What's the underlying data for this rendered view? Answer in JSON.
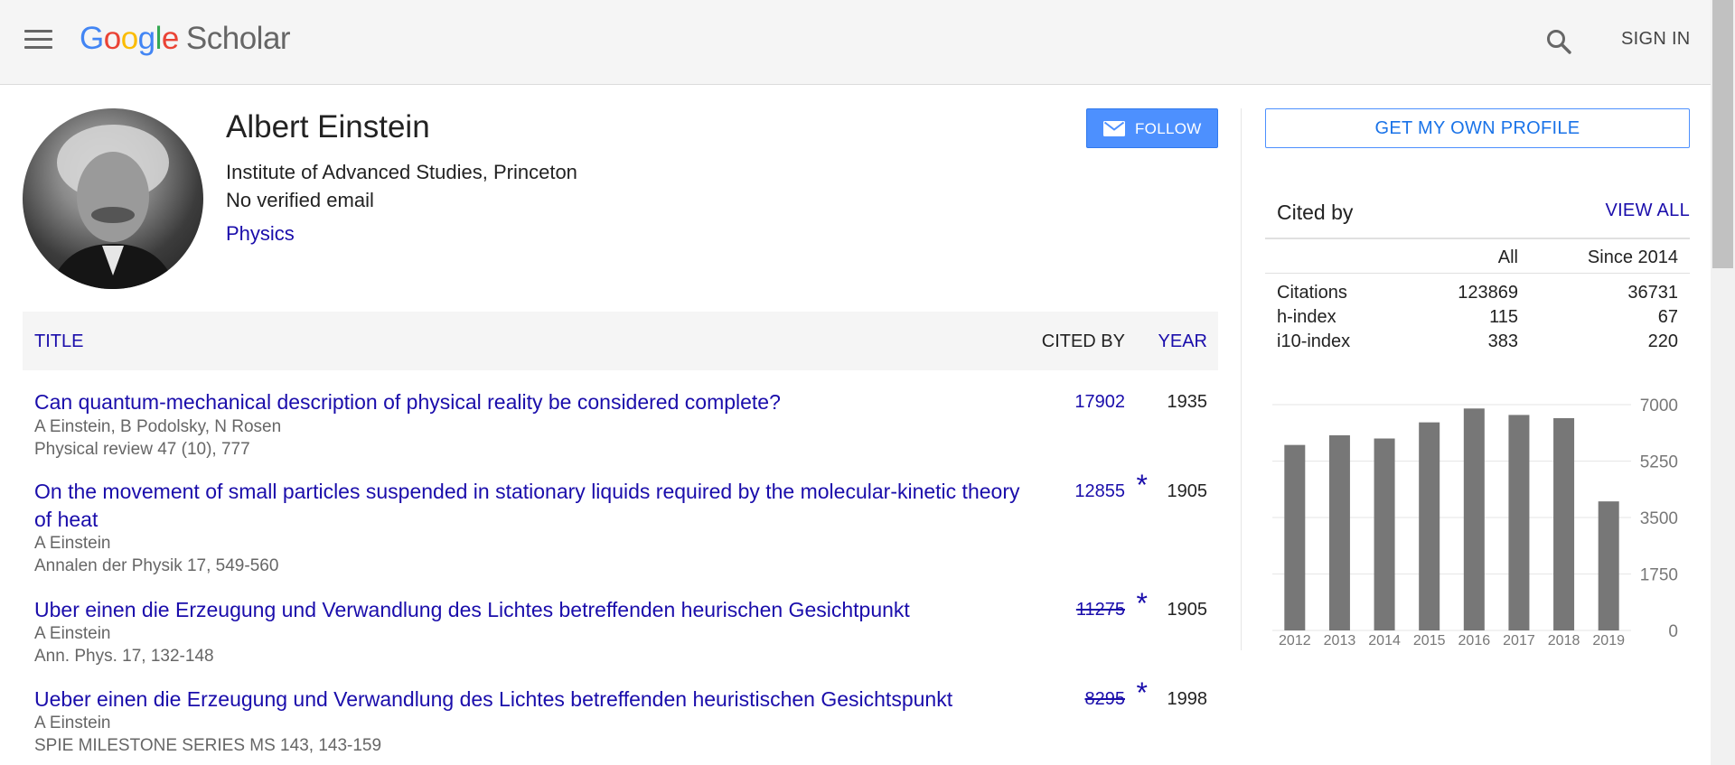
{
  "header": {
    "logo_google": "Google",
    "logo_scholar": "Scholar",
    "sign_in": "SIGN IN"
  },
  "profile": {
    "name": "Albert Einstein",
    "affiliation": "Institute of Advanced Studies, Princeton",
    "email": "No verified email",
    "interest": "Physics",
    "follow_label": "FOLLOW"
  },
  "table": {
    "col_title": "TITLE",
    "col_cited_by": "CITED BY",
    "col_year": "YEAR",
    "rows": [
      {
        "title": "Can quantum-mechanical description of physical reality be considered complete?",
        "authors": "A Einstein, B Podolsky, N Rosen",
        "publication": "Physical review 47 (10), 777",
        "cited_by": "17902",
        "star": "",
        "year": "1935"
      },
      {
        "title": "On the movement of small particles suspended in stationary liquids required by the molecular-kinetic theory of heat",
        "authors": "A Einstein",
        "publication": "Annalen der Physik 17, 549-560",
        "cited_by": "12855",
        "star": "*",
        "year": "1905"
      },
      {
        "title": "Uber einen die Erzeugung und Verwandlung des Lichtes betreffenden heurischen Gesichtpunkt",
        "authors": "A Einstein",
        "publication": "Ann. Phys. 17, 132-148",
        "cited_by": "11275",
        "star": "*",
        "year": "1905"
      },
      {
        "title": "Ueber einen die Erzeugung und Verwandlung des Lichtes betreffenden heuristischen Gesichtspunkt",
        "authors": "A Einstein",
        "publication": "SPIE MILESTONE SERIES MS 143, 143-159",
        "cited_by": "8295",
        "star": "*",
        "year": "1998"
      }
    ]
  },
  "sidebar": {
    "get_profile": "GET MY OWN PROFILE",
    "cited_by_title": "Cited by",
    "view_all": "VIEW ALL",
    "col_all": "All",
    "col_since": "Since 2014",
    "metrics": [
      {
        "label": "Citations",
        "all": "123869",
        "since": "36731"
      },
      {
        "label": "h-index",
        "all": "115",
        "since": "67"
      },
      {
        "label": "i10-index",
        "all": "383",
        "since": "220"
      }
    ]
  },
  "colors": {
    "link": "#1a0dab",
    "follow_button": "#4d90fe",
    "bar": "#777777",
    "header_bg": "#f5f5f5"
  },
  "chart_data": {
    "type": "bar",
    "categories": [
      "2012",
      "2013",
      "2014",
      "2015",
      "2016",
      "2017",
      "2018",
      "2019"
    ],
    "values": [
      5750,
      6050,
      5950,
      6450,
      6880,
      6680,
      6580,
      4000
    ],
    "ylim": [
      0,
      7000
    ],
    "yticks": [
      "0",
      "1750",
      "3500",
      "5250",
      "7000"
    ],
    "grid": true
  }
}
